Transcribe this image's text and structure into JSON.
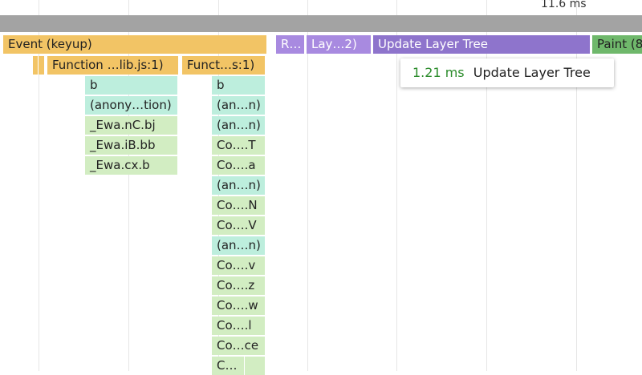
{
  "ruler": {
    "time_label": "11.6 ms"
  },
  "top_row": [
    {
      "label": "Event (keyup)",
      "color": "#f2c465"
    },
    {
      "label": "R…",
      "color": "#a88ae0"
    },
    {
      "label": "Lay…2)",
      "color": "#a88ae0"
    },
    {
      "label": "Update Layer Tree",
      "color": "#8e74cc"
    },
    {
      "label": "Paint (8",
      "color": "#6fb86b"
    }
  ],
  "function_row": [
    {
      "label": "Function …lib.js:1)"
    },
    {
      "label": "Funct…s:1)"
    }
  ],
  "stack_left": [
    "b",
    "(anony…tion)",
    "_Ewa.nC.bj",
    "_Ewa.iB.bb",
    "_Ewa.cx.b"
  ],
  "stack_right": [
    "b",
    "(an…n)",
    "(an…n)",
    "Co….T",
    "Co….a",
    "(an…n)",
    "Co….N",
    "Co….V",
    "(an…n)",
    "Co….v",
    "Co….z",
    "Co….w",
    "Co….l",
    "Co…ce",
    "C…"
  ],
  "tooltip": {
    "duration": "1.21 ms",
    "name": "Update Layer Tree"
  }
}
